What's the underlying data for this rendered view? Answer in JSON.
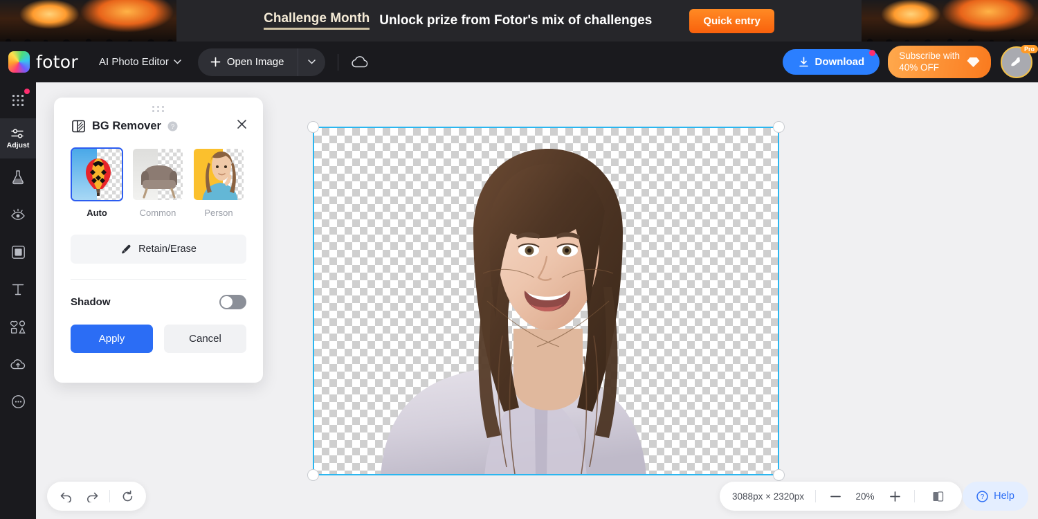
{
  "promo": {
    "title": "Challenge Month",
    "subtitle": "Unlock prize from Fotor's mix of challenges",
    "cta": "Quick entry"
  },
  "header": {
    "logo_text": "fotor",
    "mode_menu": "AI Photo Editor",
    "open_image": "Open Image",
    "download": "Download",
    "subscribe_line1": "Subscribe with",
    "subscribe_line2": "40% OFF",
    "pro_badge": "Pro"
  },
  "sidebar": {
    "items": [
      {
        "name": "apps",
        "label": ""
      },
      {
        "name": "adjust",
        "label": "Adjust"
      },
      {
        "name": "beauty",
        "label": ""
      },
      {
        "name": "retouch",
        "label": ""
      },
      {
        "name": "frame",
        "label": ""
      },
      {
        "name": "text",
        "label": ""
      },
      {
        "name": "elements",
        "label": ""
      },
      {
        "name": "upload",
        "label": ""
      },
      {
        "name": "more",
        "label": ""
      }
    ]
  },
  "panel": {
    "title": "BG Remover",
    "modes": [
      {
        "label": "Auto",
        "selected": true
      },
      {
        "label": "Common",
        "selected": false
      },
      {
        "label": "Person",
        "selected": false
      }
    ],
    "retain_erase": "Retain/Erase",
    "shadow_label": "Shadow",
    "shadow_on": false,
    "apply": "Apply",
    "cancel": "Cancel"
  },
  "statusbar": {
    "dimensions": "3088px × 2320px",
    "zoom": "20%",
    "help": "Help"
  },
  "colors": {
    "accent_blue": "#2b6df5",
    "selection_cyan": "#2ab6f0",
    "promo_orange": "#f9610c",
    "dark_chrome": "#1a1a1e"
  }
}
